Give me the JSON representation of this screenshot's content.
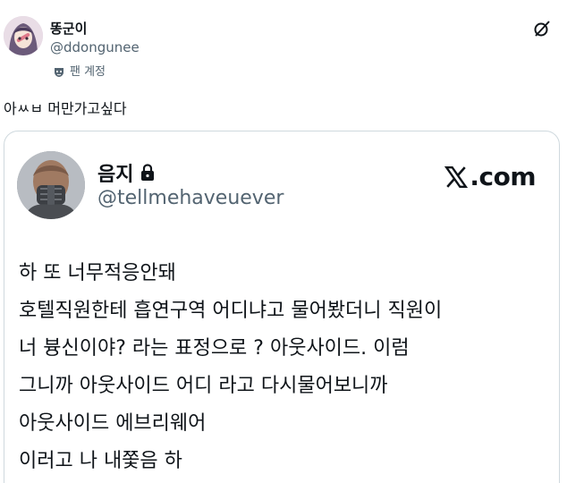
{
  "post": {
    "display_name": "똥군이",
    "handle": "@ddongunee",
    "fan_label": "팬 계정",
    "text": "아ㅆㅂ 머만가고싶다",
    "icons": {
      "fan": "mask-badge-icon",
      "grok": "grok-slash-icon"
    }
  },
  "quote": {
    "display_name": "음지",
    "handle": "@tellmehaveuever",
    "source": ".com",
    "icons": {
      "lock": "lock-icon",
      "logo": "x-logo-icon"
    },
    "lines": [
      "하 또 너무적응안돼",
      "호텔직원한테 흡연구역 어디냐고 물어봤더니 직원이",
      "너 븅신이야? 라는 표정으로 ? 아웃사이드. 이럼",
      "그니까 아웃사이드 어디 라고 다시물어보니까",
      "아웃사이드 에브리웨어",
      "이러고 나 내쫓음 하"
    ]
  },
  "colors": {
    "text": "#0f1419",
    "muted": "#536471",
    "border": "#cfd9de"
  }
}
